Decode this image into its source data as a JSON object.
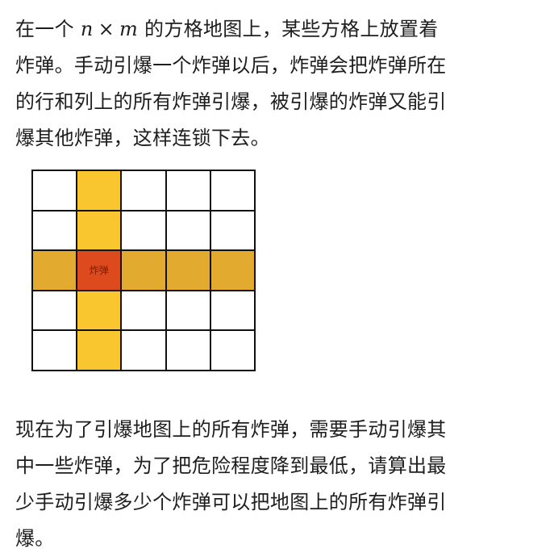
{
  "intro": {
    "line1_before": "在一个 ",
    "math_n": "n",
    "math_times": "×",
    "math_m": "m",
    "line1_after": " 的方格地图上，某些方格上放置着",
    "line2": "炸弹。手动引爆一个炸弹以后，炸弹会把炸弹所在",
    "line3": "的行和列上的所有炸弹引爆，被引爆的炸弹又能引",
    "line4": "爆其他炸弹，这样连锁下去。"
  },
  "figure": {
    "rows": 5,
    "cols": 5,
    "bomb_row": 2,
    "bomb_col": 1,
    "bomb_label": "炸弹",
    "colors": {
      "row_highlight": "#e2aa2e",
      "col_highlight": "#f9c630",
      "bomb": "#dd4a1d",
      "empty": "#ffffff",
      "grid_line": "#111111"
    }
  },
  "question": {
    "line1": "现在为了引爆地图上的所有炸弹，需要手动引爆其",
    "line2": "中一些炸弹，为了把危险程度降到最低，请算出最",
    "line3": "少手动引爆多少个炸弹可以把地图上的所有炸弹引",
    "line4": "爆。"
  }
}
